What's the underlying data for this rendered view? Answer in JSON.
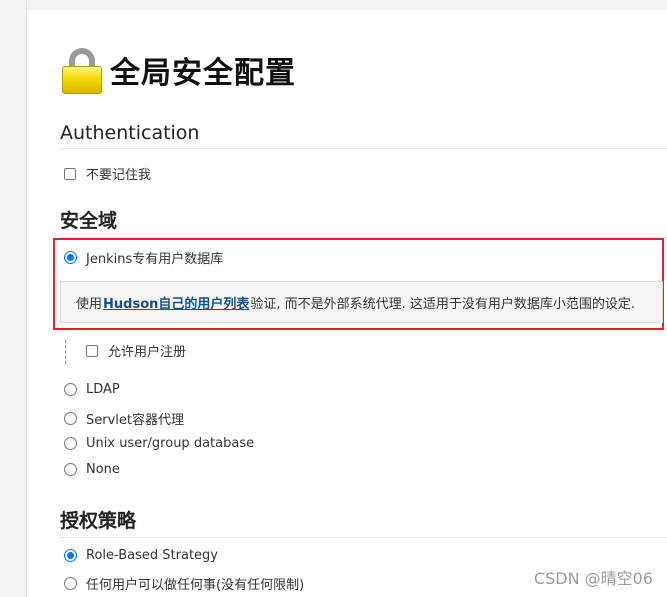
{
  "page": {
    "title": "全局安全配置"
  },
  "authentication": {
    "heading": "Authentication",
    "no_remember_me_label": "不要记住我"
  },
  "security_realm": {
    "heading": "安全域",
    "options": [
      {
        "label": "Jenkins专有用户数据库",
        "selected": true
      },
      {
        "label": "LDAP",
        "selected": false
      },
      {
        "label": "Servlet容器代理",
        "selected": false
      },
      {
        "label": "Unix user/group database",
        "selected": false
      },
      {
        "label": "None",
        "selected": false
      }
    ],
    "help": {
      "prefix": "使用",
      "link_text": "Hudson自己的用户列表",
      "suffix": "验证, 而不是外部系统代理. 这适用于没有用户数据库小范围的设定."
    },
    "allow_signup_label": "允许用户注册"
  },
  "authorization": {
    "heading": "授权策略",
    "options": [
      {
        "label": "Role-Based Strategy",
        "selected": true
      },
      {
        "label": "任何用户可以做任何事(没有任何限制)",
        "selected": false
      }
    ]
  },
  "watermark": "CSDN @晴空06",
  "colors": {
    "highlight_border": "#e8222a",
    "radio_accent": "#0075ff",
    "link": "#15508a"
  }
}
